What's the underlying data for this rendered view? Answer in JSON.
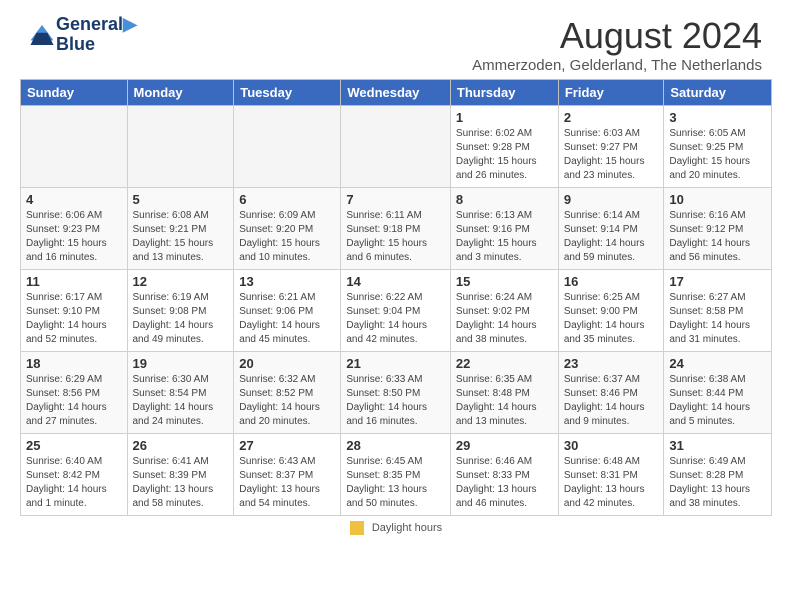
{
  "header": {
    "logo_line1": "General",
    "logo_line2": "Blue",
    "month_year": "August 2024",
    "location": "Ammerzoden, Gelderland, The Netherlands"
  },
  "days_of_week": [
    "Sunday",
    "Monday",
    "Tuesday",
    "Wednesday",
    "Thursday",
    "Friday",
    "Saturday"
  ],
  "weeks": [
    [
      {
        "day": "",
        "empty": true
      },
      {
        "day": "",
        "empty": true
      },
      {
        "day": "",
        "empty": true
      },
      {
        "day": "",
        "empty": true
      },
      {
        "day": "1",
        "sunrise": "6:02 AM",
        "sunset": "9:28 PM",
        "daylight": "15 hours and 26 minutes."
      },
      {
        "day": "2",
        "sunrise": "6:03 AM",
        "sunset": "9:27 PM",
        "daylight": "15 hours and 23 minutes."
      },
      {
        "day": "3",
        "sunrise": "6:05 AM",
        "sunset": "9:25 PM",
        "daylight": "15 hours and 20 minutes."
      }
    ],
    [
      {
        "day": "4",
        "sunrise": "6:06 AM",
        "sunset": "9:23 PM",
        "daylight": "15 hours and 16 minutes."
      },
      {
        "day": "5",
        "sunrise": "6:08 AM",
        "sunset": "9:21 PM",
        "daylight": "15 hours and 13 minutes."
      },
      {
        "day": "6",
        "sunrise": "6:09 AM",
        "sunset": "9:20 PM",
        "daylight": "15 hours and 10 minutes."
      },
      {
        "day": "7",
        "sunrise": "6:11 AM",
        "sunset": "9:18 PM",
        "daylight": "15 hours and 6 minutes."
      },
      {
        "day": "8",
        "sunrise": "6:13 AM",
        "sunset": "9:16 PM",
        "daylight": "15 hours and 3 minutes."
      },
      {
        "day": "9",
        "sunrise": "6:14 AM",
        "sunset": "9:14 PM",
        "daylight": "14 hours and 59 minutes."
      },
      {
        "day": "10",
        "sunrise": "6:16 AM",
        "sunset": "9:12 PM",
        "daylight": "14 hours and 56 minutes."
      }
    ],
    [
      {
        "day": "11",
        "sunrise": "6:17 AM",
        "sunset": "9:10 PM",
        "daylight": "14 hours and 52 minutes."
      },
      {
        "day": "12",
        "sunrise": "6:19 AM",
        "sunset": "9:08 PM",
        "daylight": "14 hours and 49 minutes."
      },
      {
        "day": "13",
        "sunrise": "6:21 AM",
        "sunset": "9:06 PM",
        "daylight": "14 hours and 45 minutes."
      },
      {
        "day": "14",
        "sunrise": "6:22 AM",
        "sunset": "9:04 PM",
        "daylight": "14 hours and 42 minutes."
      },
      {
        "day": "15",
        "sunrise": "6:24 AM",
        "sunset": "9:02 PM",
        "daylight": "14 hours and 38 minutes."
      },
      {
        "day": "16",
        "sunrise": "6:25 AM",
        "sunset": "9:00 PM",
        "daylight": "14 hours and 35 minutes."
      },
      {
        "day": "17",
        "sunrise": "6:27 AM",
        "sunset": "8:58 PM",
        "daylight": "14 hours and 31 minutes."
      }
    ],
    [
      {
        "day": "18",
        "sunrise": "6:29 AM",
        "sunset": "8:56 PM",
        "daylight": "14 hours and 27 minutes."
      },
      {
        "day": "19",
        "sunrise": "6:30 AM",
        "sunset": "8:54 PM",
        "daylight": "14 hours and 24 minutes."
      },
      {
        "day": "20",
        "sunrise": "6:32 AM",
        "sunset": "8:52 PM",
        "daylight": "14 hours and 20 minutes."
      },
      {
        "day": "21",
        "sunrise": "6:33 AM",
        "sunset": "8:50 PM",
        "daylight": "14 hours and 16 minutes."
      },
      {
        "day": "22",
        "sunrise": "6:35 AM",
        "sunset": "8:48 PM",
        "daylight": "14 hours and 13 minutes."
      },
      {
        "day": "23",
        "sunrise": "6:37 AM",
        "sunset": "8:46 PM",
        "daylight": "14 hours and 9 minutes."
      },
      {
        "day": "24",
        "sunrise": "6:38 AM",
        "sunset": "8:44 PM",
        "daylight": "14 hours and 5 minutes."
      }
    ],
    [
      {
        "day": "25",
        "sunrise": "6:40 AM",
        "sunset": "8:42 PM",
        "daylight": "14 hours and 1 minute."
      },
      {
        "day": "26",
        "sunrise": "6:41 AM",
        "sunset": "8:39 PM",
        "daylight": "13 hours and 58 minutes."
      },
      {
        "day": "27",
        "sunrise": "6:43 AM",
        "sunset": "8:37 PM",
        "daylight": "13 hours and 54 minutes."
      },
      {
        "day": "28",
        "sunrise": "6:45 AM",
        "sunset": "8:35 PM",
        "daylight": "13 hours and 50 minutes."
      },
      {
        "day": "29",
        "sunrise": "6:46 AM",
        "sunset": "8:33 PM",
        "daylight": "13 hours and 46 minutes."
      },
      {
        "day": "30",
        "sunrise": "6:48 AM",
        "sunset": "8:31 PM",
        "daylight": "13 hours and 42 minutes."
      },
      {
        "day": "31",
        "sunrise": "6:49 AM",
        "sunset": "8:28 PM",
        "daylight": "13 hours and 38 minutes."
      }
    ]
  ],
  "footer": {
    "label": "Daylight hours"
  }
}
